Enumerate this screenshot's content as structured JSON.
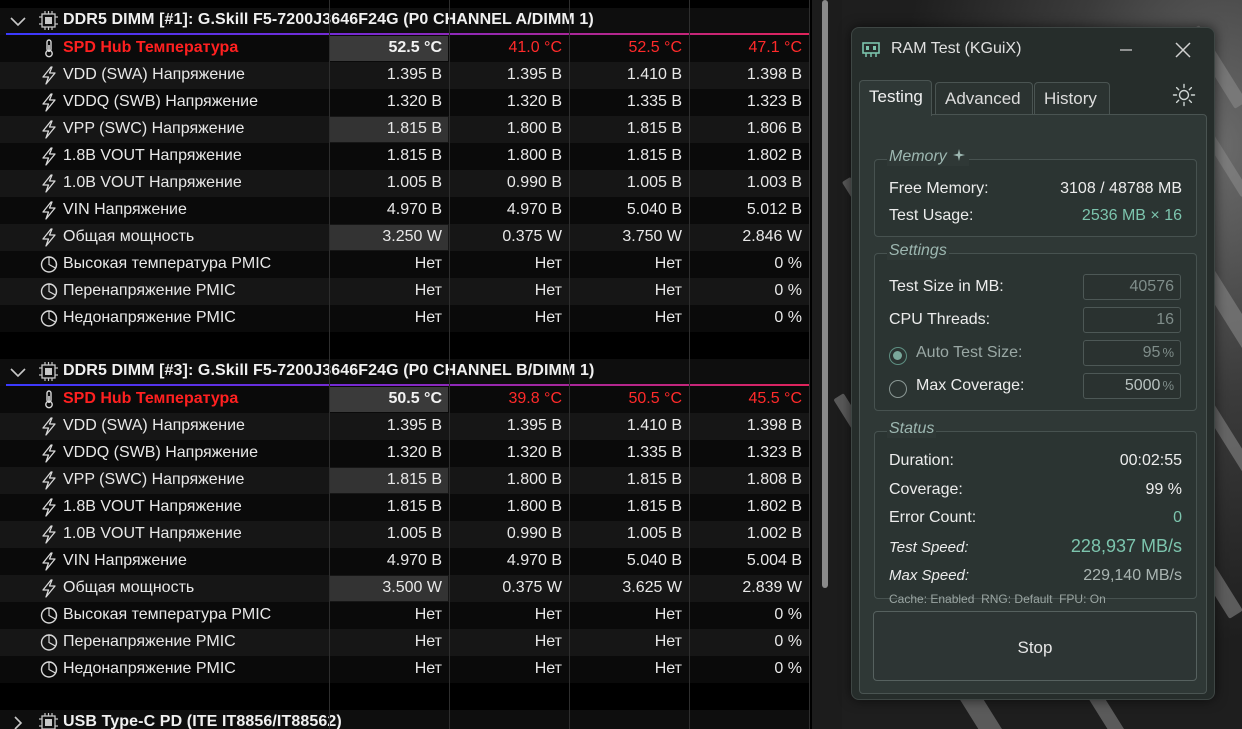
{
  "sensor_panel": {
    "sections": [
      {
        "title": "DDR5 DIMM [#1]: G.Skill F5-7200J3646F24G (P0 CHANNEL A/DIMM 1)",
        "rows": [
          {
            "label": "SPD Hub Температура",
            "values": [
              "52.5 °C",
              "41.0 °C",
              "52.5 °C",
              "47.1 °C"
            ],
            "icon": "thermometer-icon"
          },
          {
            "label": "VDD (SWA) Напряжение",
            "values": [
              "1.395 В",
              "1.395 В",
              "1.410 В",
              "1.398 В"
            ],
            "icon": "lightning-icon"
          },
          {
            "label": "VDDQ (SWB) Напряжение",
            "values": [
              "1.320 В",
              "1.320 В",
              "1.335 В",
              "1.323 В"
            ],
            "icon": "lightning-icon"
          },
          {
            "label": "VPP (SWC) Напряжение",
            "values": [
              "1.815 В",
              "1.800 В",
              "1.815 В",
              "1.806 В"
            ],
            "icon": "lightning-icon"
          },
          {
            "label": "1.8В VOUT Напряжение",
            "values": [
              "1.815 В",
              "1.800 В",
              "1.815 В",
              "1.802 В"
            ],
            "icon": "lightning-icon"
          },
          {
            "label": "1.0В VOUT Напряжение",
            "values": [
              "1.005 В",
              "0.990 В",
              "1.005 В",
              "1.003 В"
            ],
            "icon": "lightning-icon"
          },
          {
            "label": "VIN Напряжение",
            "values": [
              "4.970 В",
              "4.970 В",
              "5.040 В",
              "5.012 В"
            ],
            "icon": "lightning-icon"
          },
          {
            "label": "Общая мощность",
            "values": [
              "3.250 W",
              "0.375 W",
              "3.750 W",
              "2.846 W"
            ],
            "icon": "lightning-icon"
          },
          {
            "label": "Высокая температура PMIC",
            "values": [
              "Нет",
              "Нет",
              "Нет",
              "0 %"
            ],
            "icon": "clock-icon"
          },
          {
            "label": "Перенапряжение PMIC",
            "values": [
              "Нет",
              "Нет",
              "Нет",
              "0 %"
            ],
            "icon": "clock-icon"
          },
          {
            "label": "Недонапряжение PMIC",
            "values": [
              "Нет",
              "Нет",
              "Нет",
              "0 %"
            ],
            "icon": "clock-icon"
          }
        ]
      },
      {
        "title": "DDR5 DIMM [#3]: G.Skill F5-7200J3646F24G (P0 CHANNEL B/DIMM 1)",
        "rows": [
          {
            "label": "SPD Hub Температура",
            "values": [
              "50.5 °C",
              "39.8 °C",
              "50.5 °C",
              "45.5 °C"
            ],
            "icon": "thermometer-icon"
          },
          {
            "label": "VDD (SWA) Напряжение",
            "values": [
              "1.395 В",
              "1.395 В",
              "1.410 В",
              "1.398 В"
            ],
            "icon": "lightning-icon"
          },
          {
            "label": "VDDQ (SWB) Напряжение",
            "values": [
              "1.320 В",
              "1.320 В",
              "1.335 В",
              "1.323 В"
            ],
            "icon": "lightning-icon"
          },
          {
            "label": "VPP (SWC) Напряжение",
            "values": [
              "1.815 В",
              "1.800 В",
              "1.815 В",
              "1.808 В"
            ],
            "icon": "lightning-icon"
          },
          {
            "label": "1.8В VOUT Напряжение",
            "values": [
              "1.815 В",
              "1.800 В",
              "1.815 В",
              "1.802 В"
            ],
            "icon": "lightning-icon"
          },
          {
            "label": "1.0В VOUT Напряжение",
            "values": [
              "1.005 В",
              "0.990 В",
              "1.005 В",
              "1.002 В"
            ],
            "icon": "lightning-icon"
          },
          {
            "label": "VIN Напряжение",
            "values": [
              "4.970 В",
              "4.970 В",
              "5.040 В",
              "5.004 В"
            ],
            "icon": "lightning-icon"
          },
          {
            "label": "Общая мощность",
            "values": [
              "3.500 W",
              "0.375 W",
              "3.625 W",
              "2.839 W"
            ],
            "icon": "lightning-icon"
          },
          {
            "label": "Высокая температура PMIC",
            "values": [
              "Нет",
              "Нет",
              "Нет",
              "0 %"
            ],
            "icon": "clock-icon"
          },
          {
            "label": "Перенапряжение PMIC",
            "values": [
              "Нет",
              "Нет",
              "Нет",
              "0 %"
            ],
            "icon": "clock-icon"
          },
          {
            "label": "Недонапряжение PMIC",
            "values": [
              "Нет",
              "Нет",
              "Нет",
              "0 %"
            ],
            "icon": "clock-icon"
          }
        ]
      },
      {
        "title": "USB Type-C PD (ITE IT8856/IT88562)",
        "rows": []
      }
    ]
  },
  "ramtest": {
    "window_title": "RAM Test (KGuiX)",
    "tabs": [
      "Testing",
      "Advanced",
      "History"
    ],
    "active_tab": "Testing",
    "memory": {
      "title": "Memory",
      "free_label": "Free Memory:",
      "free_value": "3108 / 48788 MB",
      "usage_label": "Test Usage:",
      "usage_value": "2536 MB × 16"
    },
    "settings": {
      "title": "Settings",
      "test_size_label": "Test Size in MB:",
      "test_size_value": "40576",
      "cpu_threads_label": "CPU Threads:",
      "cpu_threads_value": "16",
      "auto_label": "Auto Test Size:",
      "auto_value": "95",
      "auto_selected": true,
      "max_label": "Max Coverage:",
      "max_value": "5000",
      "percent_unit": "%"
    },
    "status": {
      "title": "Status",
      "duration_label": "Duration:",
      "duration_value": "00:02:55",
      "coverage_label": "Coverage:",
      "coverage_value": "99 %",
      "errors_label": "Error Count:",
      "errors_value": "0",
      "speed_label": "Test Speed:",
      "speed_value": "228,937 MB/s",
      "max_speed_label": "Max Speed:",
      "max_speed_value": "229,140 MB/s",
      "footer": "Cache: Enabled  RNG: Default  FPU: On"
    },
    "stop_label": "Stop",
    "colors": {
      "accent": "#7cc4ad",
      "hot": "#ff2020"
    }
  }
}
